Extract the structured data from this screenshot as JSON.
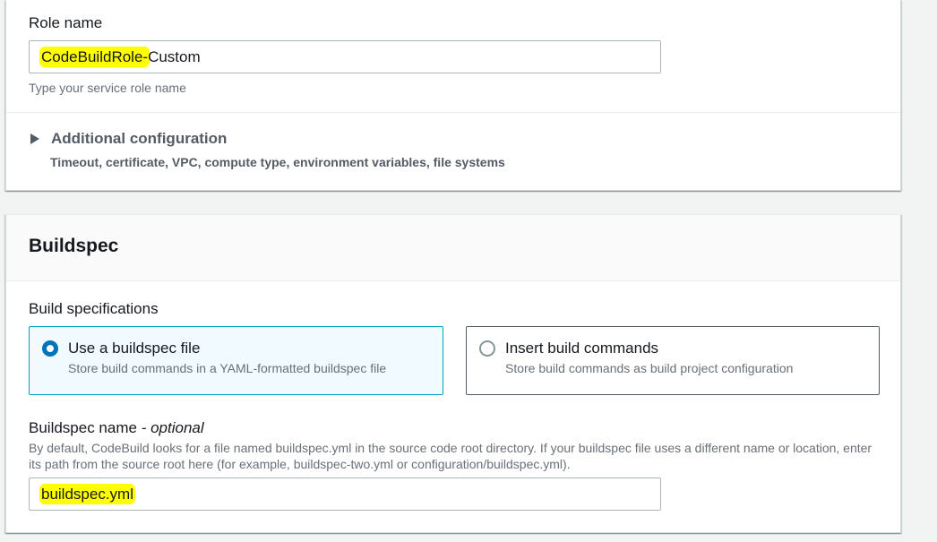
{
  "service_role": {
    "label": "Role name",
    "value_highlighted": "CodeBuildRole-",
    "value_rest": "Custom",
    "hint": "Type your service role name"
  },
  "additional_config": {
    "title": "Additional configuration",
    "description": "Timeout, certificate, VPC, compute type, environment variables, file systems"
  },
  "buildspec": {
    "title": "Buildspec",
    "spec_label": "Build specifications",
    "options": [
      {
        "title": "Use a buildspec file",
        "description": "Store build commands in a YAML-formatted buildspec file",
        "selected": true
      },
      {
        "title": "Insert build commands",
        "description": "Store build commands as build project configuration",
        "selected": false
      }
    ],
    "name_label": "Buildspec name",
    "name_label_suffix": "- optional",
    "name_description": "By default, CodeBuild looks for a file named buildspec.yml in the source code root directory. If your buildspec file uses a different name or location, enter its path from the source root here (for example, buildspec-two.yml or configuration/buildspec.yml).",
    "name_value": "buildspec.yml"
  },
  "colors": {
    "highlight": "#ffff00",
    "selected_border": "#00a1c9",
    "radio_selected": "#0073bb"
  }
}
